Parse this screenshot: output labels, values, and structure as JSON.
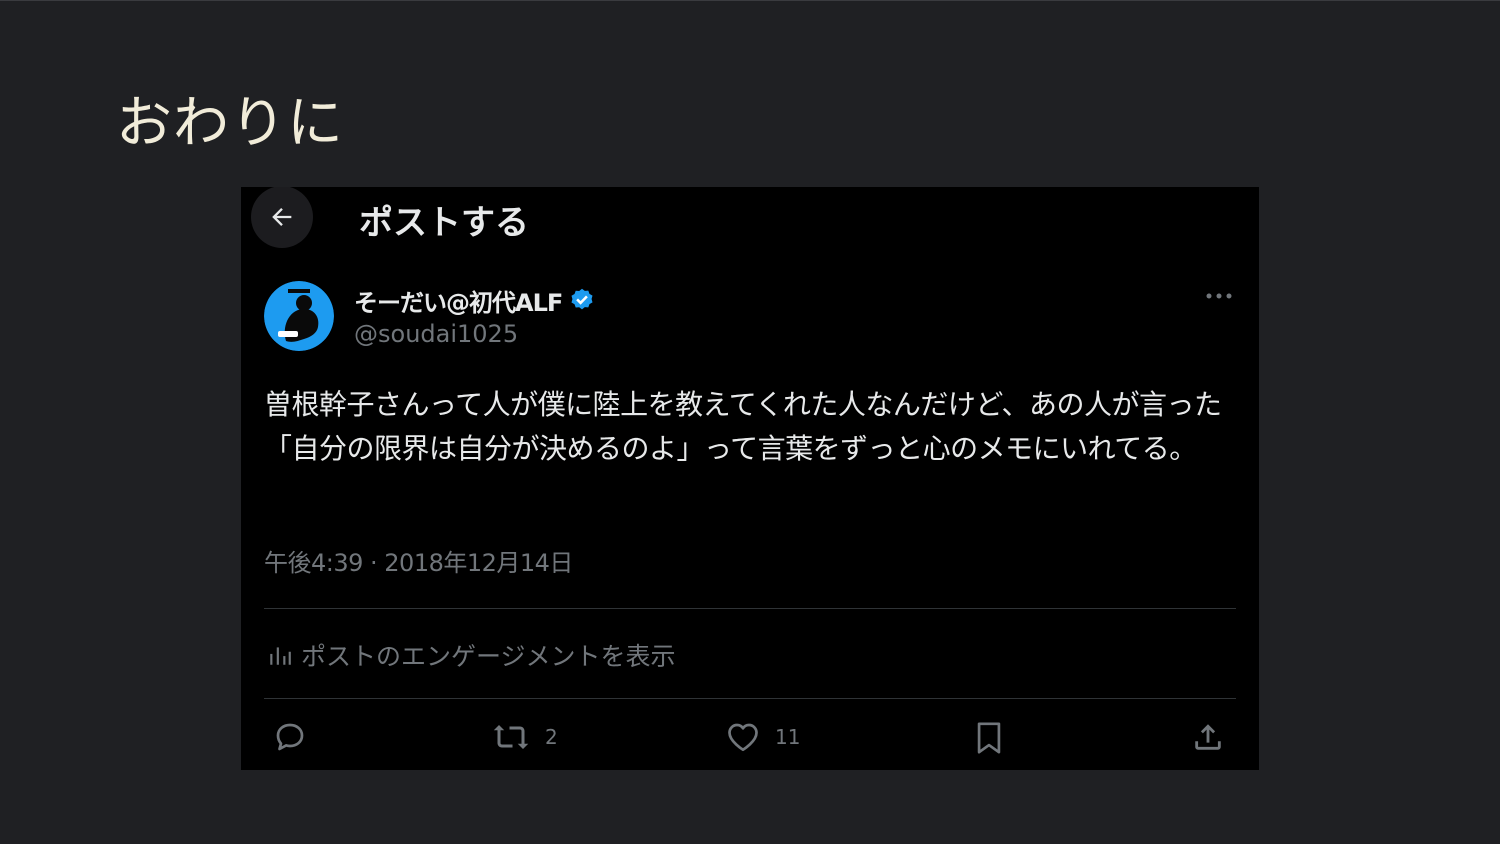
{
  "slide": {
    "title": "おわりに"
  },
  "post_view": {
    "header_title": "ポストする",
    "author": {
      "display_name": "そーだい@初代ALF",
      "handle": "@soudai1025",
      "verified": true
    },
    "body": "曽根幹子さんって人が僕に陸上を教えてくれた人なんだけど、あの人が言った「自分の限界は自分が決めるのよ」って言葉をずっと心のメモにいれてる。",
    "timestamp": "午後4:39 · 2018年12月14日",
    "engagement_label": "ポストのエンゲージメントを表示",
    "actions": {
      "reply_count": "",
      "repost_count": "2",
      "like_count": "11"
    },
    "icons": [
      "back-arrow-icon",
      "verified-badge-icon",
      "more-icon",
      "analytics-icon",
      "reply-icon",
      "repost-icon",
      "like-icon",
      "bookmark-icon",
      "share-icon"
    ],
    "colors": {
      "background": "#000000",
      "text": "#e7e9ea",
      "muted": "#71767b",
      "verified": "#1d9bf0",
      "slide_bg": "#1f2023",
      "title": "#f1ecd9"
    }
  }
}
